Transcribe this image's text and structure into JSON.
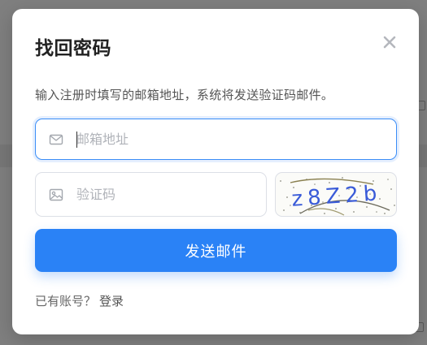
{
  "modal": {
    "title": "找回密码",
    "description": "输入注册时填写的邮箱地址，系统将发送验证码邮件。",
    "close_icon": "close-icon"
  },
  "email_field": {
    "icon": "mail-icon",
    "value": "",
    "placeholder": "邮箱地址"
  },
  "code_field": {
    "icon": "image-icon",
    "value": "",
    "placeholder": "验证码"
  },
  "captcha": {
    "text": "z8Z2b"
  },
  "submit": {
    "label": "发送邮件"
  },
  "footer": {
    "prompt": "已有账号？",
    "login_link": "登录"
  },
  "colors": {
    "primary": "#2a82f6",
    "focus_border": "#3a8df7",
    "title": "#222222",
    "text": "#555555",
    "placeholder": "#b0b3b9",
    "captcha_glyph": "#3a5bd8"
  }
}
